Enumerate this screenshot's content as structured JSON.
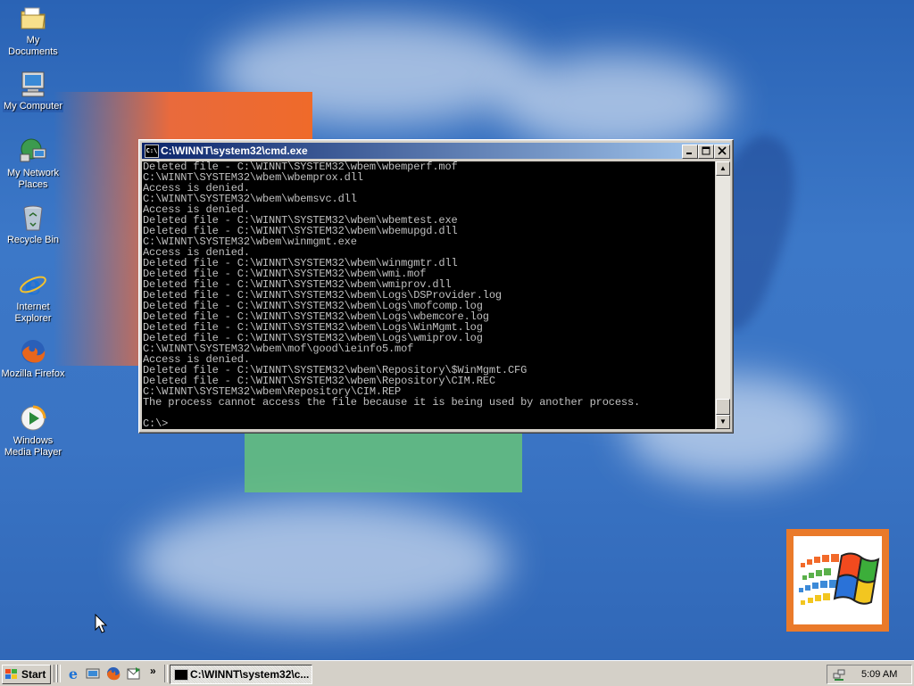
{
  "desktop": {
    "icons": [
      {
        "label": "My Documents"
      },
      {
        "label": "My Computer"
      },
      {
        "label": "My Network Places"
      },
      {
        "label": "Recycle Bin"
      },
      {
        "label": "Internet Explorer"
      },
      {
        "label": "Mozilla Firefox"
      },
      {
        "label": "Windows Media Player"
      }
    ]
  },
  "cmd_window": {
    "title": "C:\\WINNT\\system32\\cmd.exe",
    "title_icon": "C:\\",
    "lines": [
      "Deleted file - C:\\WINNT\\SYSTEM32\\wbem\\wbemperf.mof",
      "C:\\WINNT\\SYSTEM32\\wbem\\wbemprox.dll",
      "Access is denied.",
      "C:\\WINNT\\SYSTEM32\\wbem\\wbemsvc.dll",
      "Access is denied.",
      "Deleted file - C:\\WINNT\\SYSTEM32\\wbem\\wbemtest.exe",
      "Deleted file - C:\\WINNT\\SYSTEM32\\wbem\\wbemupgd.dll",
      "C:\\WINNT\\SYSTEM32\\wbem\\winmgmt.exe",
      "Access is denied.",
      "Deleted file - C:\\WINNT\\SYSTEM32\\wbem\\winmgmtr.dll",
      "Deleted file - C:\\WINNT\\SYSTEM32\\wbem\\wmi.mof",
      "Deleted file - C:\\WINNT\\SYSTEM32\\wbem\\wmiprov.dll",
      "Deleted file - C:\\WINNT\\SYSTEM32\\wbem\\Logs\\DSProvider.log",
      "Deleted file - C:\\WINNT\\SYSTEM32\\wbem\\Logs\\mofcomp.log",
      "Deleted file - C:\\WINNT\\SYSTEM32\\wbem\\Logs\\wbemcore.log",
      "Deleted file - C:\\WINNT\\SYSTEM32\\wbem\\Logs\\WinMgmt.log",
      "Deleted file - C:\\WINNT\\SYSTEM32\\wbem\\Logs\\wmiprov.log",
      "C:\\WINNT\\SYSTEM32\\wbem\\mof\\good\\ieinfo5.mof",
      "Access is denied.",
      "Deleted file - C:\\WINNT\\SYSTEM32\\wbem\\Repository\\$WinMgmt.CFG",
      "Deleted file - C:\\WINNT\\SYSTEM32\\wbem\\Repository\\CIM.REC",
      "C:\\WINNT\\SYSTEM32\\wbem\\Repository\\CIM.REP",
      "The process cannot access the file because it is being used by another process.",
      "",
      "C:\\>"
    ],
    "colors": {
      "background": "#000000",
      "text": "#c0c0c0"
    }
  },
  "taskbar": {
    "start_label": "Start",
    "task_button_label": "C:\\WINNT\\system32\\c...",
    "chevron": "»",
    "clock": "5:09 AM"
  },
  "colors": {
    "titlebar_start": "#0a246a",
    "titlebar_end": "#a6caf0",
    "chrome": "#d4d0c8",
    "desktop": "#3a74c4"
  }
}
